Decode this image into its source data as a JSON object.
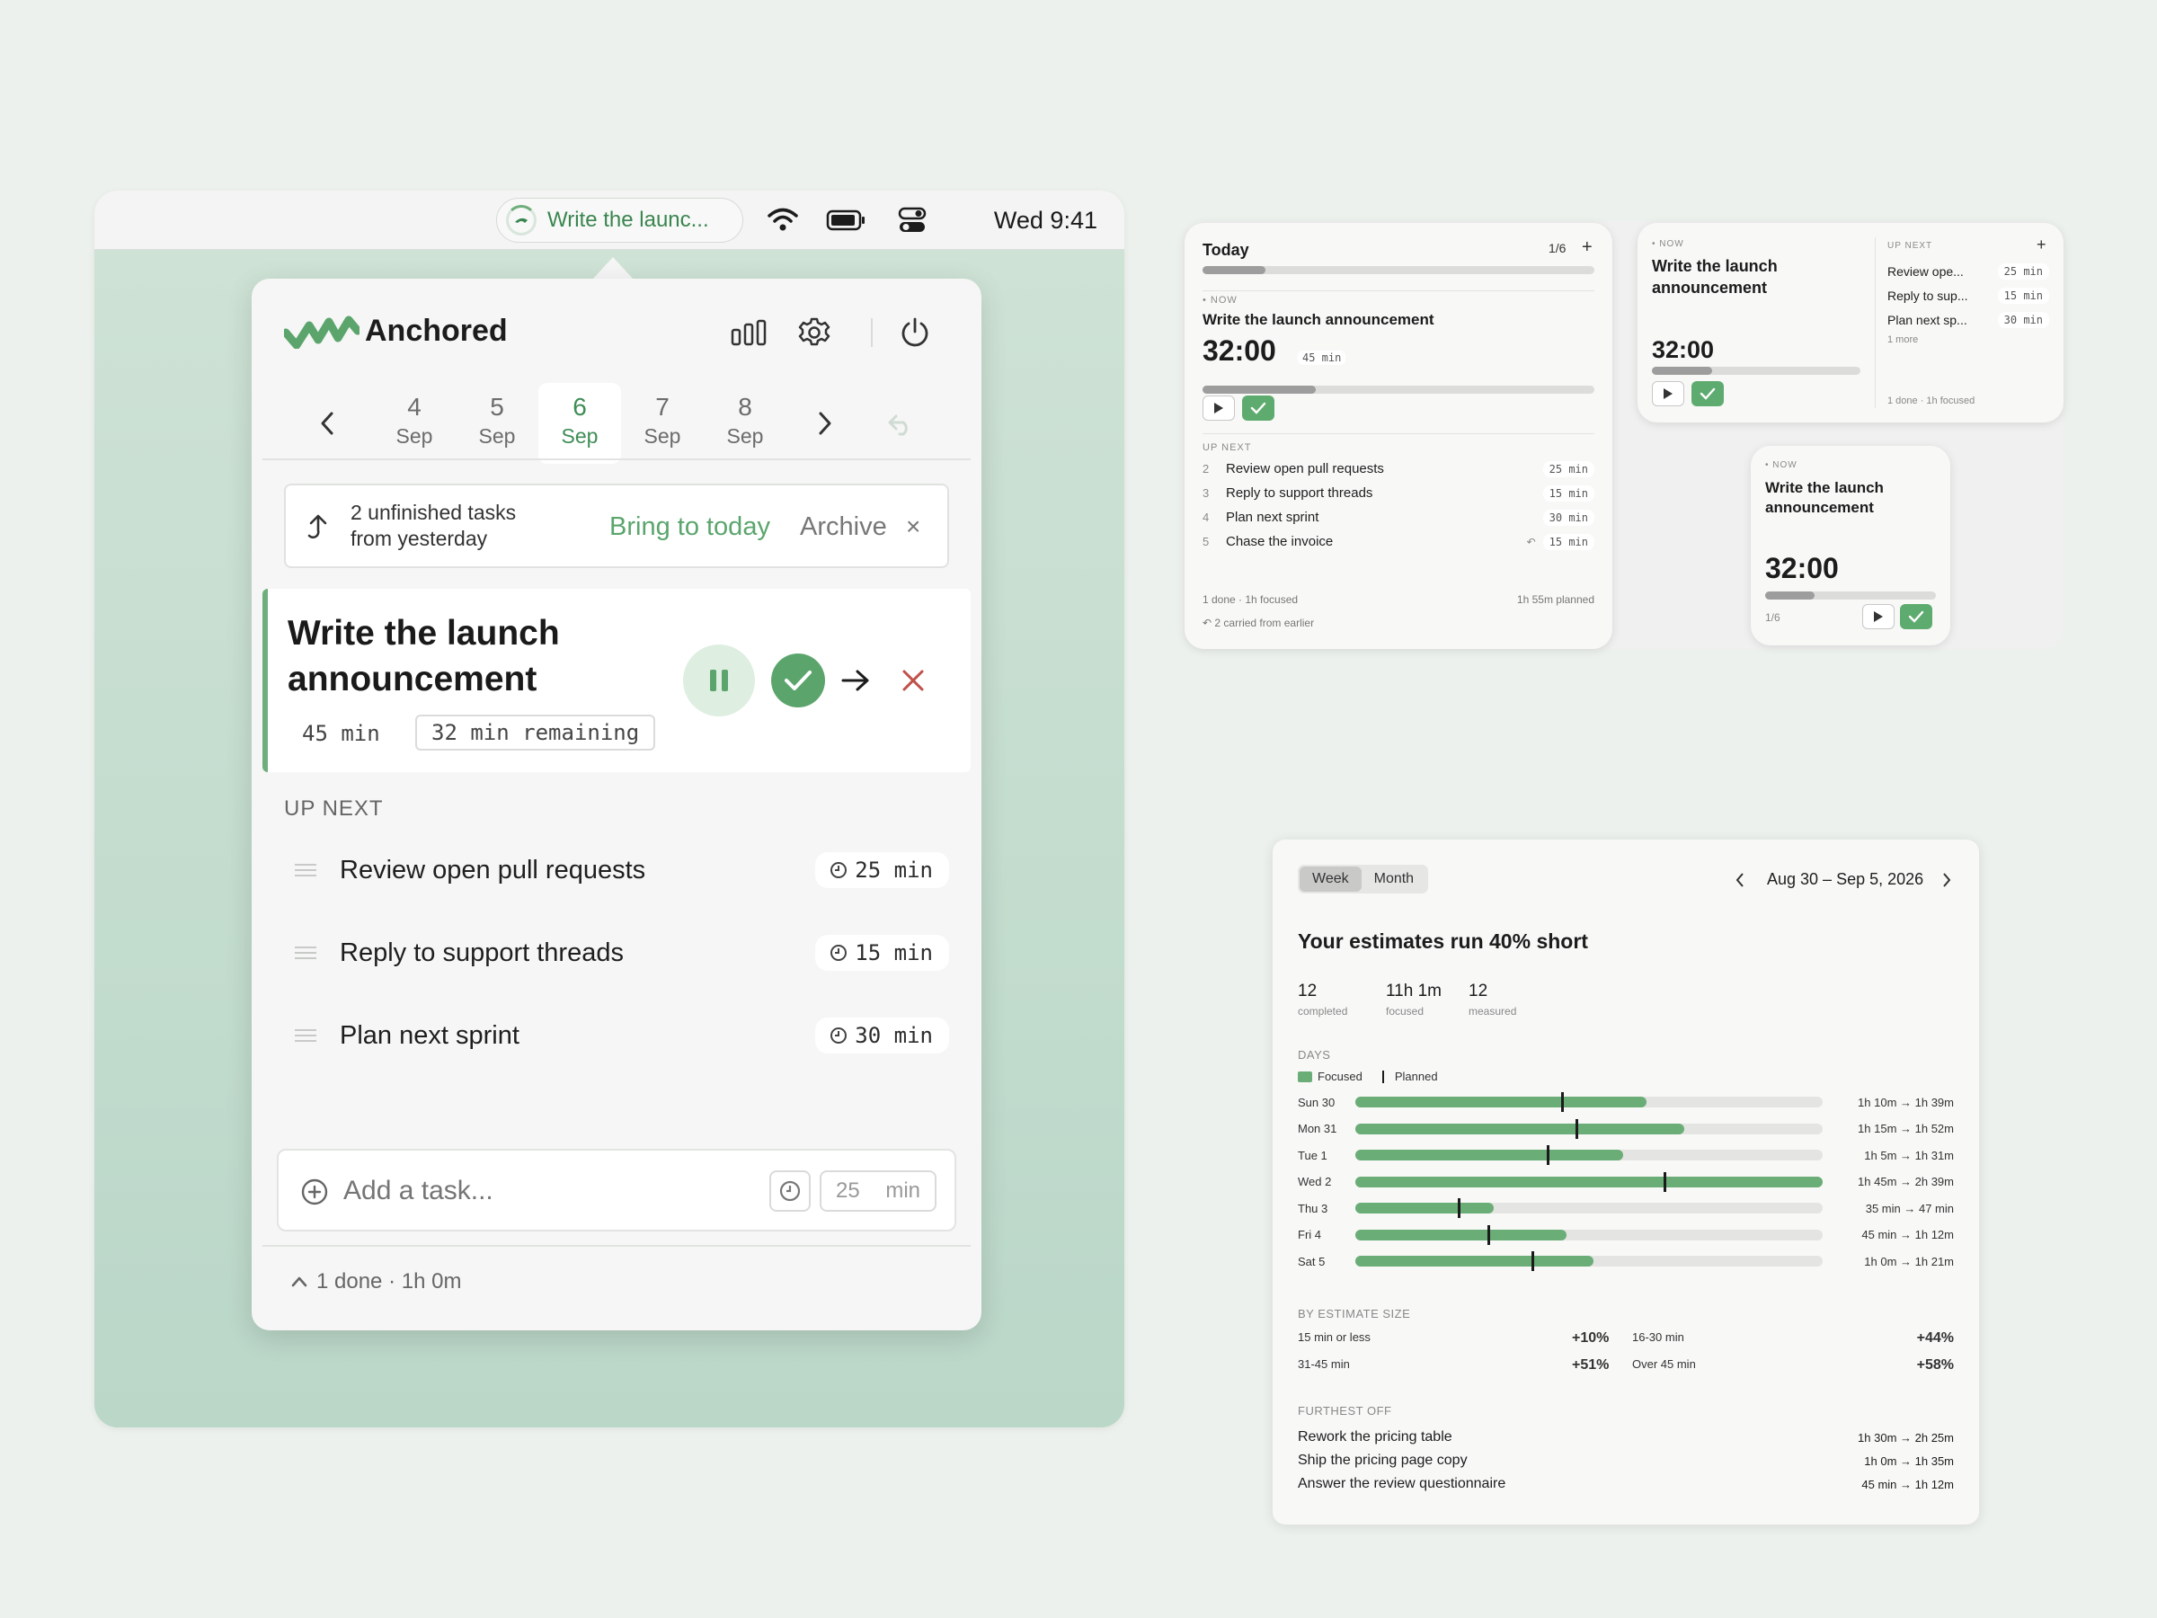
{
  "menubar": {
    "app_title": "Write the launc...",
    "clock": "Wed 9:41",
    "icons": [
      "wifi-icon",
      "battery-icon",
      "control-center-icon"
    ]
  },
  "popover": {
    "app_name": "Anchored",
    "header_icons": [
      "stats-icon",
      "gear-icon",
      "power-icon"
    ],
    "dates": [
      {
        "day": "4",
        "month": "Sep",
        "selected": false
      },
      {
        "day": "5",
        "month": "Sep",
        "selected": false
      },
      {
        "day": "6",
        "month": "Sep",
        "selected": true
      },
      {
        "day": "7",
        "month": "Sep",
        "selected": false
      },
      {
        "day": "8",
        "month": "Sep",
        "selected": false
      }
    ],
    "banner": {
      "line1": "2 unfinished tasks",
      "line2": "from yesterday",
      "bring": "Bring to today",
      "archive": "Archive",
      "close": "×"
    },
    "current": {
      "title_line1": "Write the launch",
      "title_line2": "announcement",
      "estimate": "45 min",
      "remaining": "32 min remaining"
    },
    "up_next_label": "UP NEXT",
    "up_next": [
      {
        "name": "Review open pull requests",
        "min": "25 min"
      },
      {
        "name": "Reply to support threads",
        "min": "15 min"
      },
      {
        "name": "Plan next sprint",
        "min": "30 min"
      }
    ],
    "add": {
      "placeholder": "Add a task...",
      "minutes": "25",
      "unit": "min"
    },
    "footer": "1 done · 1h 0m"
  },
  "widget_large": {
    "title": "Today",
    "count": "1/6",
    "plus": "+",
    "progress": 0.16,
    "now_label": "NOW",
    "task": "Write the launch announcement",
    "timer": "32:00",
    "est": "45 min",
    "timer_progress": 0.29,
    "up_next_label": "UP NEXT",
    "rows": [
      {
        "n": "2",
        "name": "Review open pull requests",
        "min": "25 min",
        "carried": false
      },
      {
        "n": "3",
        "name": "Reply to support threads",
        "min": "15 min",
        "carried": false
      },
      {
        "n": "4",
        "name": "Plan next sprint",
        "min": "30 min",
        "carried": false
      },
      {
        "n": "5",
        "name": "Chase the invoice",
        "min": "15 min",
        "carried": true
      }
    ],
    "footer_left": "1 done · 1h focused",
    "footer_right": "1h 55m planned",
    "carried": "2 carried from earlier"
  },
  "widget_medium": {
    "now_label": "NOW",
    "task_line1": "Write the launch",
    "task_line2": "announcement",
    "timer": "32:00",
    "timer_progress": 0.29,
    "up_next_label": "UP NEXT",
    "plus": "+",
    "rows": [
      {
        "name": "Review ope...",
        "min": "25 min"
      },
      {
        "name": "Reply to sup...",
        "min": "15 min"
      },
      {
        "name": "Plan next sp...",
        "min": "30 min"
      }
    ],
    "more": "1 more",
    "footer": "1 done · 1h focused"
  },
  "widget_small": {
    "now_label": "NOW",
    "task_line1": "Write the launch",
    "task_line2": "announcement",
    "timer": "32:00",
    "timer_progress": 0.29,
    "count": "1/6"
  },
  "analytics": {
    "tabs": [
      {
        "label": "Week",
        "selected": true
      },
      {
        "label": "Month",
        "selected": false
      }
    ],
    "range": "Aug 30 – Sep 5, 2026",
    "headline": "Your estimates run 40% short",
    "stats": [
      {
        "value": "12",
        "label": "completed"
      },
      {
        "value": "11h 1m",
        "label": "focused"
      },
      {
        "value": "12",
        "label": "measured"
      }
    ],
    "days_label": "DAYS",
    "legend_focused": "Focused",
    "legend_planned": "Planned",
    "colors": {
      "focused": "#6aad77",
      "track": "#e4e4e3",
      "planned": "#1b1b1b"
    },
    "days": [
      {
        "label": "Sun 30",
        "text": "1h 10m → 1h 39m",
        "planned_min": 70,
        "focused_min": 99
      },
      {
        "label": "Mon 31",
        "text": "1h 15m → 1h 52m",
        "planned_min": 75,
        "focused_min": 112
      },
      {
        "label": "Tue 1",
        "text": "1h 5m → 1h 31m",
        "planned_min": 65,
        "focused_min": 91
      },
      {
        "label": "Wed 2",
        "text": "1h 45m → 2h 39m",
        "planned_min": 105,
        "focused_min": 159
      },
      {
        "label": "Thu 3",
        "text": "35 min → 47 min",
        "planned_min": 35,
        "focused_min": 47
      },
      {
        "label": "Fri 4",
        "text": "45 min → 1h 12m",
        "planned_min": 45,
        "focused_min": 72
      },
      {
        "label": "Sat 5",
        "text": "1h 0m → 1h 21m",
        "planned_min": 60,
        "focused_min": 81
      }
    ],
    "scale_max_min": 159,
    "size_label": "BY ESTIMATE SIZE",
    "sizes": [
      {
        "label": "15 min or less",
        "value": "+10%"
      },
      {
        "label": "16-30 min",
        "value": "+44%"
      },
      {
        "label": "31-45 min",
        "value": "+51%"
      },
      {
        "label": "Over 45 min",
        "value": "+58%"
      }
    ],
    "furthest_label": "FURTHEST OFF",
    "furthest": [
      {
        "name": "Rework the pricing table",
        "value": "1h 30m → 2h 25m"
      },
      {
        "name": "Ship the pricing page copy",
        "value": "1h 0m → 1h 35m"
      },
      {
        "name": "Answer the review questionnaire",
        "value": "45 min → 1h 12m"
      }
    ]
  }
}
